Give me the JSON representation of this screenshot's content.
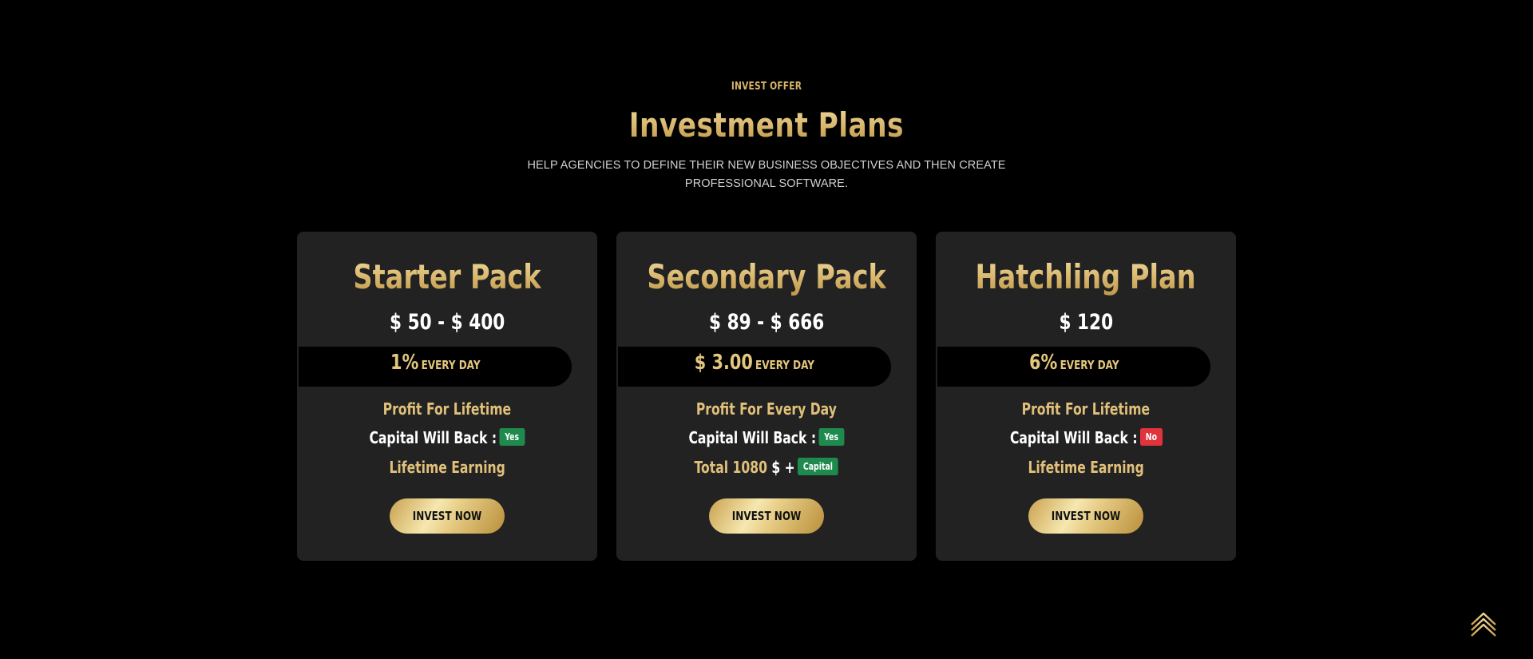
{
  "section": {
    "eyebrow": "INVEST OFFER",
    "title": "Investment Plans",
    "subtitle": "HELP AGENCIES TO DEFINE THEIR NEW BUSINESS OBJECTIVES AND THEN CREATE PROFESSIONAL SOFTWARE."
  },
  "plans": [
    {
      "title": "Starter Pack",
      "price": "$ 50 - $ 400",
      "rate_value": "1%",
      "rate_unit": "EVERY DAY",
      "profit_prefix": "Profit",
      "profit_suffix": "For Lifetime",
      "capital_label": "Capital Will Back :",
      "capital_badge": "Yes",
      "earning_prefix": "Lifetime",
      "earning_suffix": "Earning",
      "button_label": "INVEST NOW"
    },
    {
      "title": "Secondary Pack",
      "price": "$ 89 - $ 666",
      "rate_value": "$ 3.00",
      "rate_unit": "EVERY DAY",
      "profit_prefix": "Profit",
      "profit_suffix": "For Every Day",
      "capital_label": "Capital Will Back :",
      "capital_badge": "Yes",
      "total_prefix": "Total",
      "total_value": "1080",
      "total_suffix": "$ +",
      "total_badge": "Capital",
      "button_label": "INVEST NOW"
    },
    {
      "title": "Hatchling Plan",
      "price": "$ 120",
      "rate_value": "6%",
      "rate_unit": "EVERY DAY",
      "profit_prefix": "Profit",
      "profit_suffix": "For Lifetime",
      "capital_label": "Capital Will Back :",
      "capital_badge": "No",
      "earning_prefix": "Lifetime",
      "earning_suffix": "Earning",
      "button_label": "INVEST NOW"
    }
  ],
  "colors": {
    "accent_gold": "#d8b56a",
    "badge_yes": "#1e8a4e",
    "badge_no": "#e0333b",
    "card_bg": "#222222",
    "page_bg": "#000000"
  },
  "scroll_top_icon": "double-chevron-up-icon"
}
